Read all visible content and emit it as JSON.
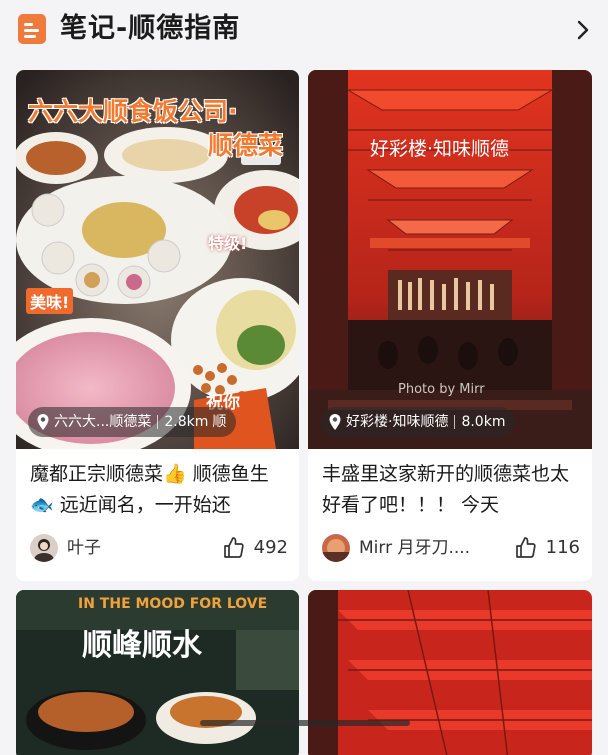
{
  "header": {
    "title": "笔记-顺德指南",
    "icon": "note-icon",
    "chevron_icon": "chevron-right-icon"
  },
  "cards": [
    {
      "overlay_title_1": "六六大顺食饭公司·",
      "overlay_title_2": "顺德菜",
      "sticker_1": "特级!",
      "sticker_2": "美味!",
      "sticker_3": "祝你",
      "location_name": "六六大...顺德菜",
      "distance": "2.8km",
      "location_suffix": "顺",
      "description": "魔都正宗顺德菜👍 顺德鱼生🐟 远近闻名，一开始还",
      "author": "叶子",
      "likes": "492"
    },
    {
      "overlay_title": "好彩楼·知味顺德",
      "watermark": "Photo by Mirr",
      "location_name": "好彩楼·知味顺德",
      "distance": "8.0km",
      "description": "丰盛里这家新开的顺德菜也太好看了吧！！！ 今天",
      "author": "Mirr 月牙刀....",
      "likes": "116"
    },
    {
      "overlay_top": "IN THE MOOD FOR LOVE",
      "overlay_title": "顺峰顺水"
    },
    {}
  ],
  "colors": {
    "accent": "#f07a3b",
    "text": "#1b1b1b"
  }
}
